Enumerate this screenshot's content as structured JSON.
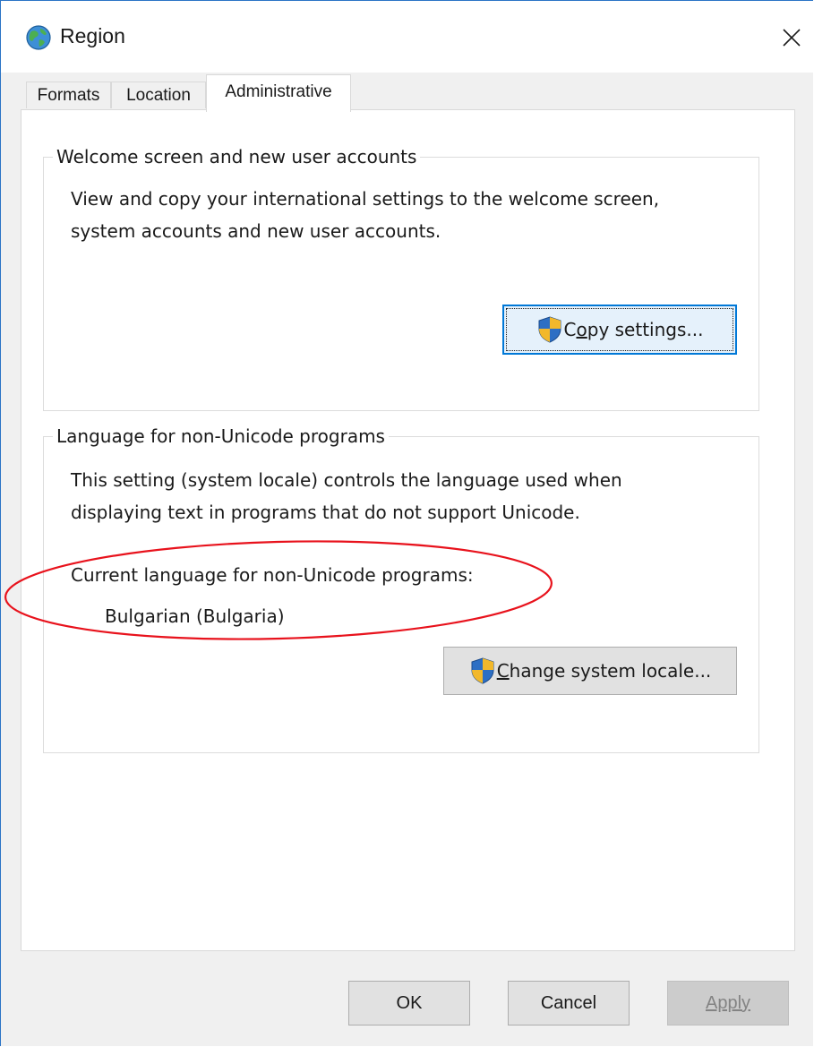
{
  "window": {
    "title": "Region",
    "close_glyph": "✕",
    "icon": "globe-icon",
    "accent_color": "#0078d7"
  },
  "tabs": [
    {
      "label": "Formats",
      "active": false
    },
    {
      "label": "Location",
      "active": false
    },
    {
      "label": "Administrative",
      "active": true
    }
  ],
  "welcome_group": {
    "title": "Welcome screen and new user accounts",
    "description_line1": "View and copy your international settings to the welcome screen,",
    "description_line2": "system accounts and new user accounts.",
    "button": {
      "label_prefix": "C",
      "label_access_key": "o",
      "label_suffix": "py settings...",
      "icon": "uac-shield-icon"
    }
  },
  "non_unicode_group": {
    "title": "Language for non-Unicode programs",
    "description_line1": "This setting (system locale) controls the language used when",
    "description_line2": "displaying text in programs that do not support Unicode.",
    "current_label": "Current language for non-Unicode programs:",
    "current_value": "Bulgarian (Bulgaria)",
    "button": {
      "label_access_key": "C",
      "label_suffix": "hange system locale...",
      "icon": "uac-shield-icon"
    }
  },
  "annotation": {
    "shape": "ellipse",
    "color": "#e8121c"
  },
  "footer": {
    "ok_label": "OK",
    "cancel_label": "Cancel",
    "apply_label": "Apply",
    "apply_disabled": true
  }
}
